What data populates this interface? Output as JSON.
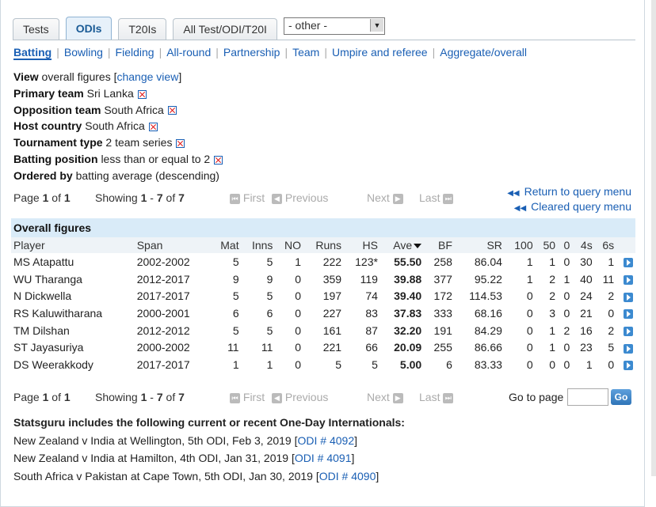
{
  "tabs": [
    "Tests",
    "ODIs",
    "T20Is",
    "All Test/ODI/T20I"
  ],
  "active_tab": 1,
  "select": {
    "value": "- other -"
  },
  "subnav": [
    "Batting",
    "Bowling",
    "Fielding",
    "All-round",
    "Partnership",
    "Team",
    "Umpire and referee",
    "Aggregate/overall"
  ],
  "filters": {
    "view_label": "View",
    "view_value": "overall figures",
    "change_view": "change view",
    "primary_label": "Primary team",
    "primary_value": "Sri Lanka",
    "opp_label": "Opposition team",
    "opp_value": "South Africa",
    "host_label": "Host country",
    "host_value": "South Africa",
    "tourn_label": "Tournament type",
    "tourn_value": "2 team series",
    "pos_label": "Batting position",
    "pos_value": "less than or equal to 2",
    "order_label": "Ordered by",
    "order_value": "batting average (descending)"
  },
  "pager": {
    "page_text": "Page",
    "page_cur": "1",
    "of": "of",
    "page_total": "1",
    "showing": "Showing",
    "from": "1",
    "to": "7",
    "total": "7",
    "first": "First",
    "previous": "Previous",
    "next": "Next",
    "last": "Last"
  },
  "query_links": {
    "return": "Return to query menu",
    "cleared": "Cleared query menu"
  },
  "table": {
    "caption": "Overall figures",
    "headers": [
      "Player",
      "Span",
      "Mat",
      "Inns",
      "NO",
      "Runs",
      "HS",
      "Ave",
      "BF",
      "SR",
      "100",
      "50",
      "0",
      "4s",
      "6s"
    ],
    "rows": [
      [
        "MS Atapattu",
        "2002-2002",
        "5",
        "5",
        "1",
        "222",
        "123*",
        "55.50",
        "258",
        "86.04",
        "1",
        "1",
        "0",
        "30",
        "1"
      ],
      [
        "WU Tharanga",
        "2012-2017",
        "9",
        "9",
        "0",
        "359",
        "119",
        "39.88",
        "377",
        "95.22",
        "1",
        "2",
        "1",
        "40",
        "11"
      ],
      [
        "N Dickwella",
        "2017-2017",
        "5",
        "5",
        "0",
        "197",
        "74",
        "39.40",
        "172",
        "114.53",
        "0",
        "2",
        "0",
        "24",
        "2"
      ],
      [
        "RS Kaluwitharana",
        "2000-2001",
        "6",
        "6",
        "0",
        "227",
        "83",
        "37.83",
        "333",
        "68.16",
        "0",
        "3",
        "0",
        "21",
        "0"
      ],
      [
        "TM Dilshan",
        "2012-2012",
        "5",
        "5",
        "0",
        "161",
        "87",
        "32.20",
        "191",
        "84.29",
        "0",
        "1",
        "2",
        "16",
        "2"
      ],
      [
        "ST Jayasuriya",
        "2000-2002",
        "11",
        "11",
        "0",
        "221",
        "66",
        "20.09",
        "255",
        "86.66",
        "0",
        "1",
        "0",
        "23",
        "5"
      ],
      [
        "DS Weerakkody",
        "2017-2017",
        "1",
        "1",
        "0",
        "5",
        "5",
        "5.00",
        "6",
        "83.33",
        "0",
        "0",
        "0",
        "1",
        "0"
      ]
    ]
  },
  "goto": {
    "label": "Go to page",
    "button": "Go"
  },
  "statsguru": {
    "heading": "Statsguru includes the following current or recent One-Day Internationals:",
    "matches": [
      {
        "text": "New Zealand v India at Wellington, 5th ODI, Feb 3, 2019",
        "link": "ODI # 4092"
      },
      {
        "text": "New Zealand v India at Hamilton, 4th ODI, Jan 31, 2019",
        "link": "ODI # 4091"
      },
      {
        "text": "South Africa v Pakistan at Cape Town, 5th ODI, Jan 30, 2019",
        "link": "ODI # 4090"
      }
    ]
  }
}
